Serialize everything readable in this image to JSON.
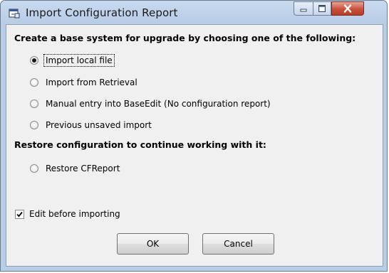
{
  "window": {
    "title": "Import Configuration Report",
    "icon": "app-icon",
    "controls": {
      "minimize": "minimize-icon",
      "maximize": "maximize-icon",
      "close": "close-icon"
    }
  },
  "section1": {
    "heading": "Create a base system for upgrade by choosing one of the following:",
    "options": [
      {
        "label": "Import local file",
        "checked": true
      },
      {
        "label": "Import from Retrieval",
        "checked": false
      },
      {
        "label": "Manual entry into BaseEdit (No configuration report)",
        "checked": false
      },
      {
        "label": "Previous unsaved import",
        "checked": false
      }
    ]
  },
  "section2": {
    "heading": "Restore configuration to continue working with it:",
    "options": [
      {
        "label": "Restore CFReport",
        "checked": false
      }
    ]
  },
  "edit_before": {
    "label": "Edit before importing",
    "checked": true
  },
  "buttons": {
    "ok": "OK",
    "cancel": "Cancel"
  },
  "colors": {
    "title_gradient_top": "#c9daef",
    "client_bg": "#f0f0f0",
    "close_red": "#c8503a"
  }
}
